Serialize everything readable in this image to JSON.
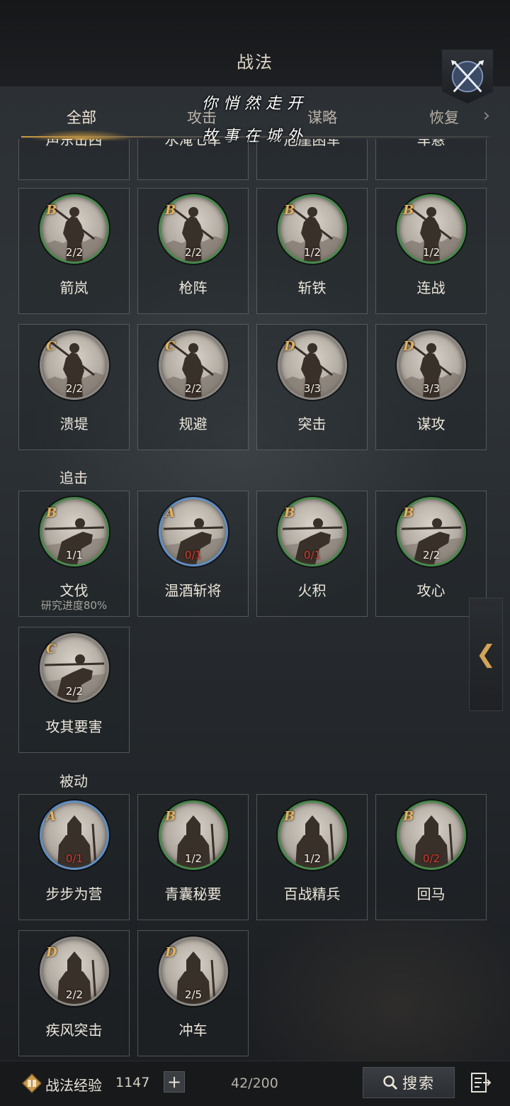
{
  "header": {
    "title": "战法"
  },
  "tabs": [
    {
      "label": "全部",
      "active": true
    },
    {
      "label": "攻击",
      "active": false
    },
    {
      "label": "谋略",
      "active": false
    },
    {
      "label": "恢复",
      "active": false
    }
  ],
  "overlay": {
    "line1": "你悄然走开",
    "line2": "故事在城外"
  },
  "top_partial_row": [
    "声东击西",
    "水淹七军",
    "危崖困军",
    "车悬"
  ],
  "rows": [
    [
      {
        "name": "箭岚",
        "grade": "B",
        "count": "2/2"
      },
      {
        "name": "枪阵",
        "grade": "B",
        "count": "2/2"
      },
      {
        "name": "斩铁",
        "grade": "B",
        "count": "1/2"
      },
      {
        "name": "连战",
        "grade": "B",
        "count": "1/2"
      }
    ],
    [
      {
        "name": "溃堤",
        "grade": "C",
        "count": "2/2"
      },
      {
        "name": "规避",
        "grade": "C",
        "count": "2/2"
      },
      {
        "name": "突击",
        "grade": "D",
        "count": "3/3"
      },
      {
        "name": "谋攻",
        "grade": "D",
        "count": "3/3"
      }
    ]
  ],
  "sections": [
    {
      "title": "追击",
      "items": [
        {
          "name": "文伐",
          "grade": "B",
          "count": "1/1",
          "sub": "研究进度80%"
        },
        {
          "name": "温酒斩将",
          "grade": "A",
          "count": "0/1"
        },
        {
          "name": "火积",
          "grade": "B",
          "count": "0/1"
        },
        {
          "name": "攻心",
          "grade": "B",
          "count": "2/2"
        },
        {
          "name": "攻其要害",
          "grade": "C",
          "count": "2/2"
        }
      ]
    },
    {
      "title": "被动",
      "items": [
        {
          "name": "步步为营",
          "grade": "A",
          "count": "0/1"
        },
        {
          "name": "青囊秘要",
          "grade": "B",
          "count": "1/2"
        },
        {
          "name": "百战精兵",
          "grade": "B",
          "count": "1/2"
        },
        {
          "name": "回马",
          "grade": "B",
          "count": "0/2"
        },
        {
          "name": "疾风突击",
          "grade": "D",
          "count": "2/2"
        },
        {
          "name": "冲车",
          "grade": "D",
          "count": "2/5"
        }
      ]
    }
  ],
  "side_handle": {
    "glyph": "❮"
  },
  "footer": {
    "exp_label": "战法经验",
    "exp_value": "1147",
    "plus": "+",
    "capacity": "42/200",
    "search_label": "搜索"
  },
  "icons": {
    "close": "crossed-swords-icon",
    "exp": "exp-book-icon",
    "search": "search-icon",
    "menu": "list-exit-icon"
  }
}
